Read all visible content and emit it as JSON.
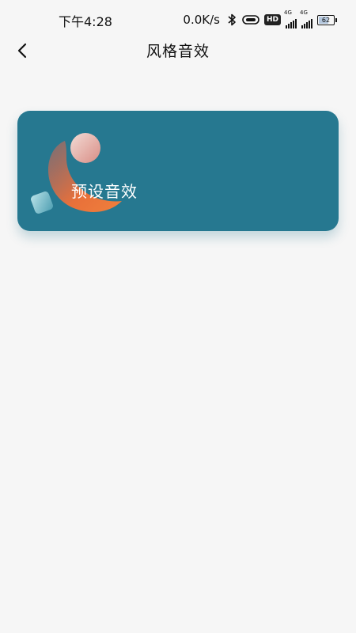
{
  "status_bar": {
    "time": "下午4:28",
    "net_speed": "0.0K/s",
    "hd_badge": "HD",
    "sim1_network": "4G",
    "sim2_network": "4G",
    "battery_level": "62",
    "icons": [
      "bluetooth-icon",
      "link-icon",
      "hd-icon",
      "signal-icon",
      "battery-icon"
    ]
  },
  "header": {
    "title": "风格音效",
    "back_icon": "chevron-left-icon"
  },
  "cards": [
    {
      "label": "预设音效",
      "background_color": "#267890"
    }
  ],
  "colors": {
    "page_background": "#f6f6f6",
    "card_background": "#267890",
    "accent_orange": "#e8703a"
  }
}
